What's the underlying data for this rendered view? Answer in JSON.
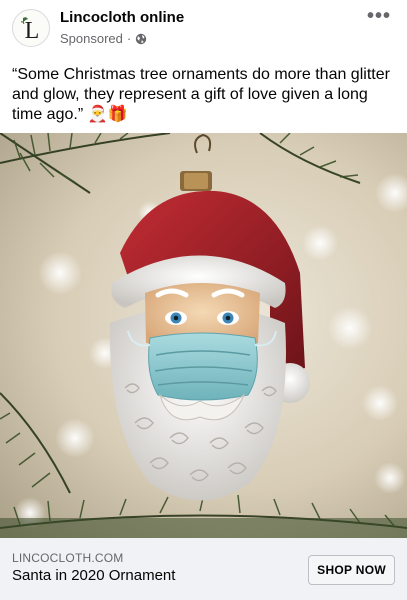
{
  "post": {
    "page_name": "Lincocloth online",
    "sponsored_label": "Sponsored",
    "sponsored_separator": "·",
    "avatar_letter": "L",
    "more_label": "•••",
    "text": "“Some Christmas tree ornaments do more than glitter and glow, they represent a gift of love given a long time ago.” 🎅🎁"
  },
  "link_card": {
    "domain": "LINCOCLOTH.COM",
    "headline": "Santa in 2020 Ornament",
    "cta_label": "SHOP NOW"
  },
  "icons": {
    "privacy": "globe-icon",
    "more": "more-options-icon",
    "avatar": "page-logo-icon"
  },
  "colors": {
    "text_primary": "#050505",
    "text_secondary": "#65676b",
    "cta_background": "#f0f2f5",
    "santa_hat_red": "#a8222a",
    "mask_blue": "#8cc9cf"
  }
}
